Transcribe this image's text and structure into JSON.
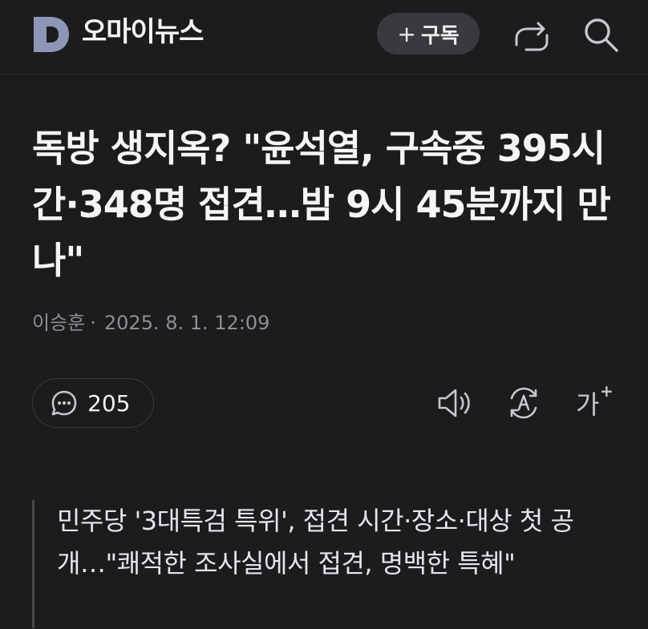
{
  "header": {
    "brand": "오마이뉴스",
    "subscribe_plus": "+",
    "subscribe_label": "구독",
    "icons": {
      "logo": "d-logo",
      "share": "share-icon",
      "search": "search-icon"
    }
  },
  "article": {
    "title": "독방 생지옥? \"윤석열, 구속중 395시간·348명 접견…밤 9시 45분까지 만나\"",
    "author": "이승훈",
    "separator": "·",
    "datetime": "2025. 8. 1. 12:09",
    "comment_count": "205",
    "summary": "민주당 '3대특검 특위', 접견 시간·장소·대상 첫 공개…\"쾌적한 조사실에서 접견, 명백한 특혜\""
  },
  "toolbar": {
    "font_glyph": "가",
    "font_plus": "+",
    "icons": [
      "comment-icon",
      "speaker-icon",
      "translate-icon",
      "font-size-icon"
    ]
  },
  "colors": {
    "background": "#1c1c1e",
    "logo": "#8e96b8",
    "text_primary": "#f5f5f5",
    "text_secondary": "#8e8e93",
    "button_bg": "#3a3a3e"
  }
}
